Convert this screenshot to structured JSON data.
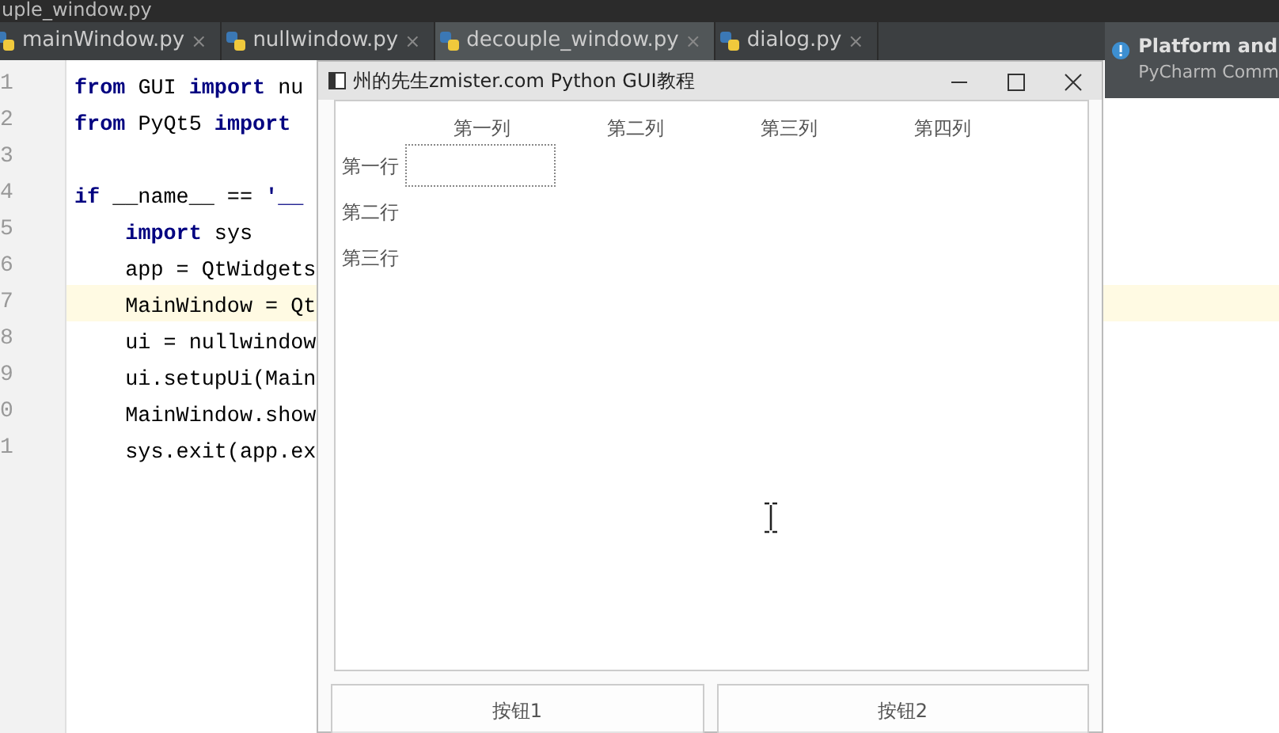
{
  "window": {
    "title": "uple_window.py"
  },
  "tabs": [
    {
      "label": "mainWindow.py",
      "close": "×",
      "selected": false
    },
    {
      "label": "nullwindow.py",
      "close": "×",
      "selected": false
    },
    {
      "label": "decouple_window.py",
      "close": "×",
      "selected": true
    },
    {
      "label": "dialog.py",
      "close": "×",
      "selected": false
    }
  ],
  "editor": {
    "lines": [
      {
        "number": "1",
        "code": "**from** GUI **import** nu",
        "current": false
      },
      {
        "number": "2",
        "code": "**from** PyQt5 **import**",
        "current": false
      },
      {
        "number": "3",
        "current": false
      },
      {
        "number": "4",
        "code": "**if** __name__ == **'__**",
        "current": false
      },
      {
        "number": "5",
        "code": "    **import** sys",
        "current": false
      },
      {
        "number": "6",
        "code": "    app = QtWidgets",
        "current": false
      },
      {
        "number": "7",
        "code": "    MainWindow = Qt",
        "current": true
      },
      {
        "number": "8",
        "code": "    ui = nullwindow",
        "current": false
      },
      {
        "number": "9",
        "code": "    ui.setupUi(Main",
        "current": false
      },
      {
        "number": "0",
        "code": "    MainWindow.show",
        "current": false
      },
      {
        "number": "1",
        "code": "    sys.exit(app.ex",
        "current": false
      }
    ]
  },
  "notification": {
    "title": "Platform and",
    "subtitle": "PyCharm Comm"
  },
  "app_window": {
    "title": "州的先生zmister.com Python GUI教程",
    "table": {
      "columns": [
        "第一列",
        "第二列",
        "第三列",
        "第四列"
      ],
      "rows": [
        {
          "label": "第一行",
          "cells": [
            {
              "focused": true
            },
            {
              "focused": false
            },
            {
              "focused": false
            },
            {
              "focused": false
            }
          ]
        },
        {
          "label": "第二行",
          "cells": [
            {
              "focused": false
            },
            {
              "focused": false
            },
            {
              "focused": false
            },
            {
              "focused": false
            }
          ]
        },
        {
          "label": "第三行",
          "cells": [
            {
              "focused": false
            },
            {
              "focused": false
            },
            {
              "focused": false
            },
            {
              "focused": false
            }
          ]
        }
      ]
    },
    "buttons": [
      "按钮1",
      "按钮2"
    ]
  }
}
